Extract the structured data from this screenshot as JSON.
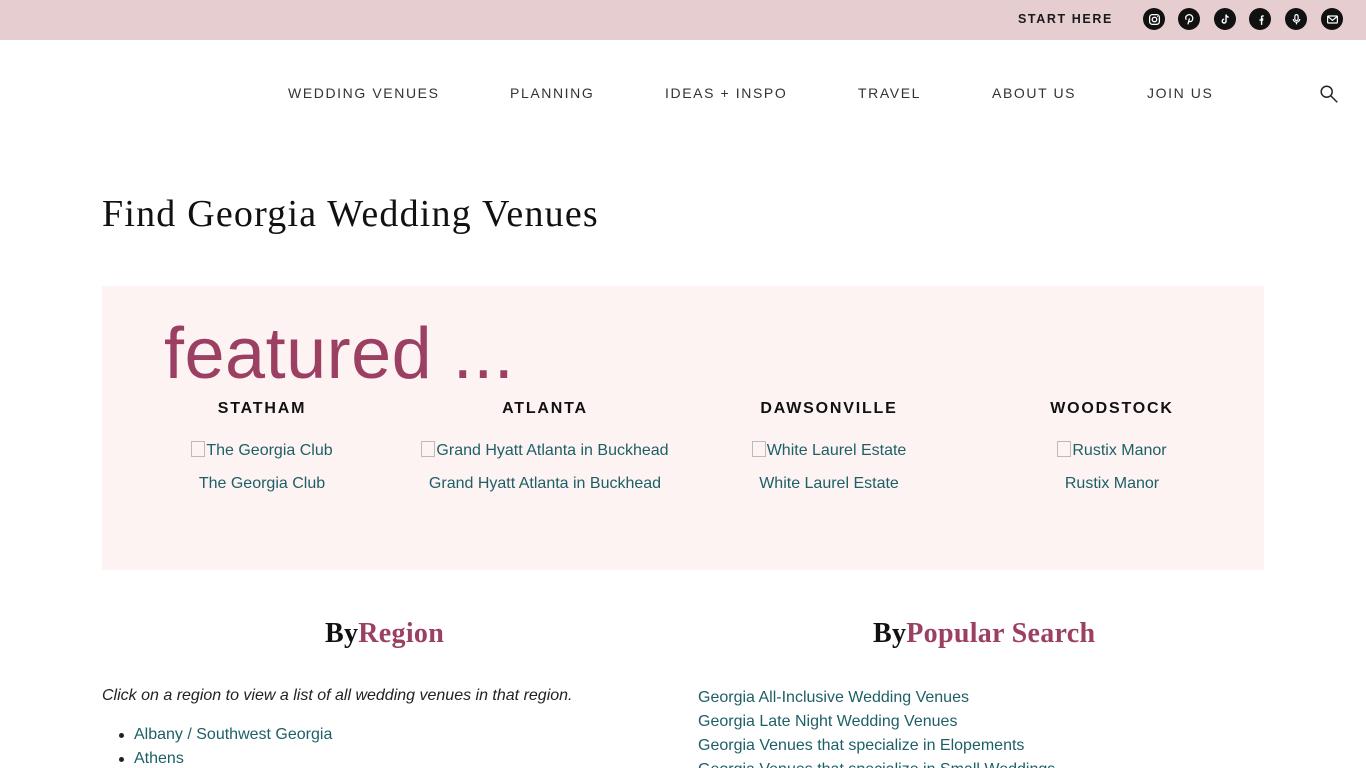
{
  "topbar": {
    "start_label": "START HERE",
    "social_icons": [
      "instagram-icon",
      "pinterest-icon",
      "tiktok-icon",
      "facebook-icon",
      "podcast-icon",
      "email-icon"
    ]
  },
  "nav": {
    "items": [
      "WEDDING VENUES",
      "PLANNING",
      "IDEAS + INSPO",
      "TRAVEL",
      "ABOUT US",
      "JOIN US"
    ]
  },
  "page": {
    "title": "Find Georgia Wedding Venues"
  },
  "featured": {
    "heading": "featured ...",
    "venues": [
      {
        "city": "STATHAM",
        "image_alt": "The Georgia Club",
        "name": "The Georgia Club"
      },
      {
        "city": "ATLANTA",
        "image_alt": "Grand Hyatt Atlanta in Buckhead",
        "name": "Grand Hyatt Atlanta in Buckhead"
      },
      {
        "city": "DAWSONVILLE",
        "image_alt": "White Laurel Estate",
        "name": "White Laurel Estate"
      },
      {
        "city": "WOODSTOCK",
        "image_alt": "Rustix Manor",
        "name": "Rustix Manor"
      }
    ]
  },
  "by_region": {
    "prefix": "By",
    "accent": "Region",
    "intro": "Click on a region to view a list of all wedding venues in that region.",
    "items": [
      "Albany / Southwest Georgia",
      "Athens"
    ]
  },
  "by_popular": {
    "prefix": "By",
    "accent": "Popular Search",
    "items": [
      "Georgia All-Inclusive Wedding Venues",
      "Georgia Late Night Wedding Venues",
      "Georgia Venues that specialize in Elopements",
      "Georgia Venues that specialize in Small Weddings"
    ]
  },
  "colors": {
    "topbar_bg": "#e5cdd0",
    "accent": "#9b3f63",
    "link": "#1d5f66",
    "featured_bg": "#fdf3f2"
  }
}
